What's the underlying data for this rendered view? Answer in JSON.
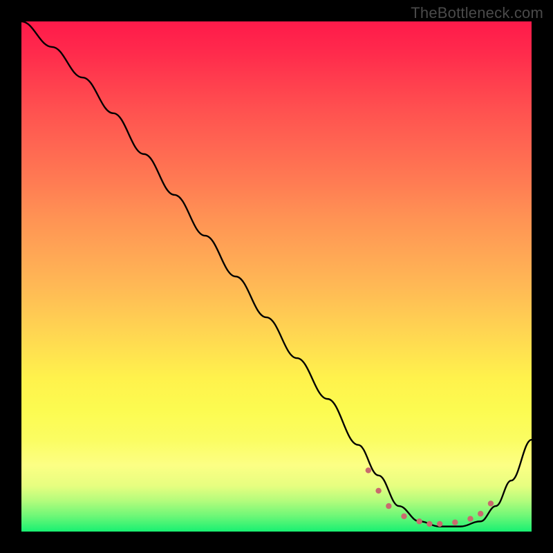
{
  "watermark": "TheBottleneck.com",
  "chart_data": {
    "type": "line",
    "title": "",
    "xlabel": "",
    "ylabel": "",
    "xlim": [
      0,
      100
    ],
    "ylim": [
      0,
      100
    ],
    "series": [
      {
        "name": "bottleneck-curve",
        "x": [
          0,
          6,
          12,
          18,
          24,
          30,
          36,
          42,
          48,
          54,
          60,
          66,
          70,
          74,
          78,
          82,
          86,
          90,
          93,
          96,
          100
        ],
        "values": [
          100,
          95,
          89,
          82,
          74,
          66,
          58,
          50,
          42,
          34,
          26,
          17,
          11,
          5,
          2,
          1,
          1,
          2,
          5,
          10,
          18
        ]
      }
    ],
    "markers": {
      "name": "bottom-dots",
      "color": "#c96a6e",
      "radius": 4.2,
      "x": [
        68,
        70,
        72,
        75,
        78,
        80,
        82,
        85,
        88,
        90,
        92
      ],
      "values": [
        12,
        8,
        5,
        3,
        2,
        1.5,
        1.5,
        1.8,
        2.5,
        3.5,
        5.5
      ]
    },
    "gradient_stops": [
      {
        "pos": 0,
        "color": "#ff1a4a"
      },
      {
        "pos": 25,
        "color": "#ff6852"
      },
      {
        "pos": 50,
        "color": "#ffb355"
      },
      {
        "pos": 75,
        "color": "#fef94e"
      },
      {
        "pos": 90,
        "color": "#d9fe7f"
      },
      {
        "pos": 100,
        "color": "#18f072"
      }
    ]
  }
}
